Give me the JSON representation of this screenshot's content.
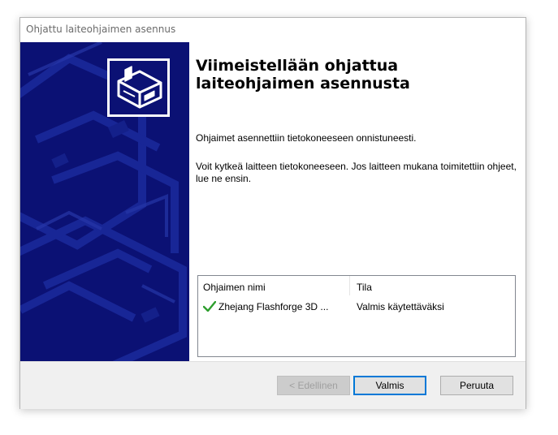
{
  "window": {
    "title": "Ohjattu laiteohjaimen asennus"
  },
  "banner": {
    "background_color": "#0b1174",
    "icon": "hardware-device-icon"
  },
  "content": {
    "heading": "Viimeistellään ohjattua laiteohjaimen asennusta",
    "paragraph1": "Ohjaimet asennettiin tietokoneeseen onnistuneesti.",
    "paragraph2": "Voit kytkeä laitteen tietokoneeseen. Jos laitteen mukana toimitettiin ohjeet, lue ne ensin."
  },
  "driver_list": {
    "columns": [
      "Ohjaimen nimi",
      "Tila"
    ],
    "rows": [
      {
        "icon": "check-icon",
        "name": "Zhejang Flashforge 3D ...",
        "status": "Valmis käytettäväksi"
      }
    ]
  },
  "buttons": {
    "back": "< Edellinen",
    "finish": "Valmis",
    "cancel": "Peruuta"
  },
  "colors": {
    "accent": "#0078d7",
    "check": "#2e9e2e"
  }
}
